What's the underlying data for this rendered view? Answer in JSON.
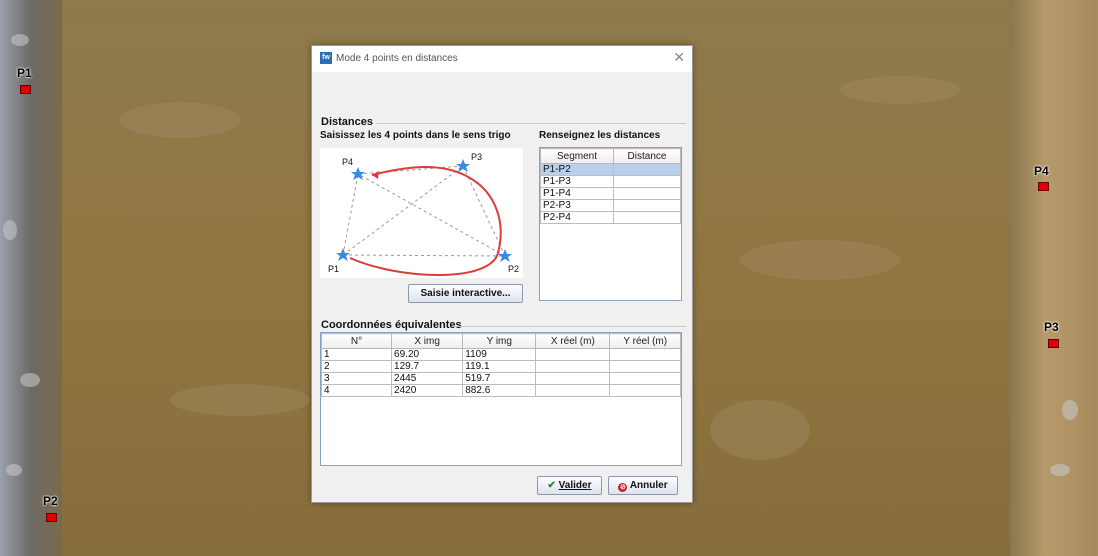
{
  "background": {
    "point_labels": [
      "P1",
      "P2",
      "P3",
      "P4"
    ]
  },
  "dialog": {
    "title": "Mode 4 points en distances",
    "icon_text": "fw",
    "close_symbol": "✕",
    "distances_group": {
      "title": "Distances",
      "left_label": "Saisissez les 4 points dans le sens trigo",
      "right_label": "Renseignez les distances",
      "diagram_points": [
        "P1",
        "P2",
        "P3",
        "P4"
      ],
      "interactive_button": "Saisie interactive...",
      "segment_table": {
        "columns": [
          "Segment",
          "Distance"
        ],
        "rows": [
          {
            "segment": "P1-P2",
            "distance": "",
            "selected": true
          },
          {
            "segment": "P1-P3",
            "distance": "",
            "selected": false
          },
          {
            "segment": "P1-P4",
            "distance": "",
            "selected": false
          },
          {
            "segment": "P2-P3",
            "distance": "",
            "selected": false
          },
          {
            "segment": "P2-P4",
            "distance": "",
            "selected": false
          }
        ]
      }
    },
    "coords_group": {
      "title": "Coordonnées équivalentes",
      "columns": [
        "N°",
        "X img",
        "Y img",
        "X réel (m)",
        "Y réel (m)"
      ],
      "rows": [
        [
          "1",
          "69.20",
          "1109",
          "",
          ""
        ],
        [
          "2",
          "129.7",
          "119.1",
          "",
          ""
        ],
        [
          "3",
          "2445",
          "519.7",
          "",
          ""
        ],
        [
          "4",
          "2420",
          "882.6",
          "",
          ""
        ]
      ]
    },
    "buttons": {
      "validate": "Valider",
      "cancel": "Annuler"
    }
  },
  "colors": {
    "river": "#8f7640",
    "accent_curve": "#e03a3a",
    "star": "#3a8be0",
    "selection": "#b8d0ec",
    "marker": "#e00000"
  }
}
